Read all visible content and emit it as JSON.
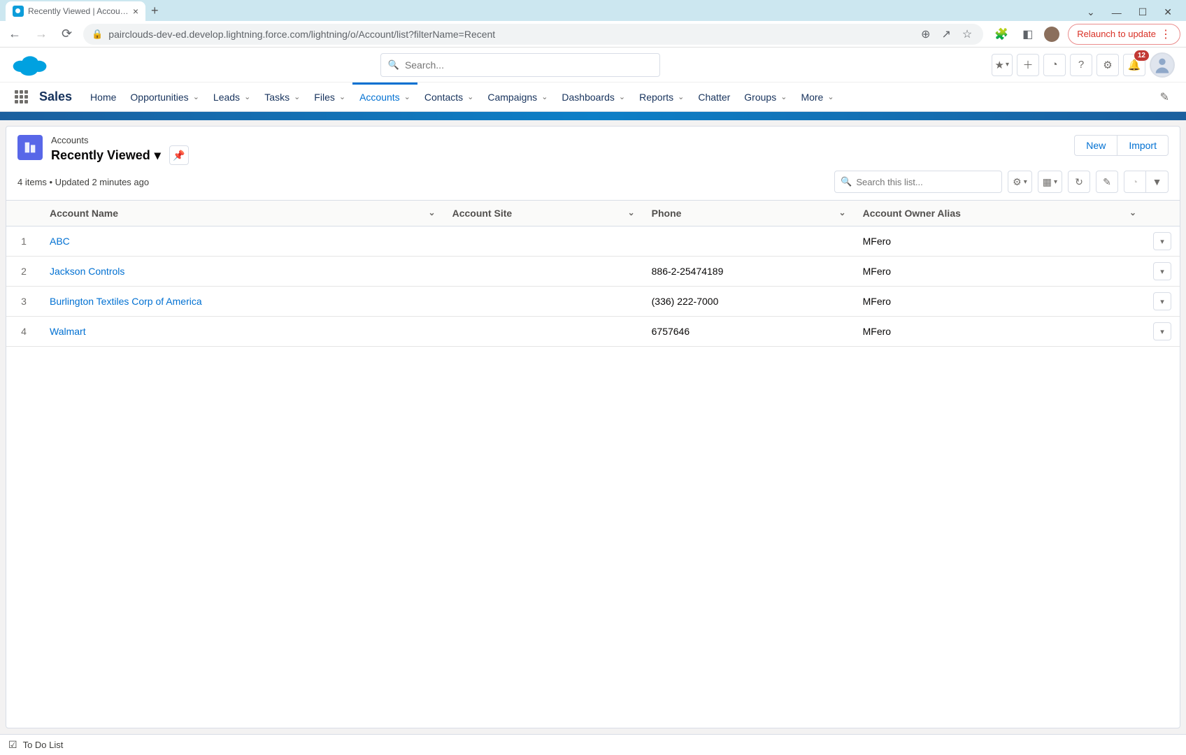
{
  "browser": {
    "tab_title": "Recently Viewed | Accounts | Sal",
    "url": "pairclouds-dev-ed.develop.lightning.force.com/lightning/o/Account/list?filterName=Recent",
    "relaunch_label": "Relaunch to update"
  },
  "header": {
    "search_placeholder": "Search...",
    "notification_count": "12"
  },
  "nav": {
    "app_name": "Sales",
    "tabs": [
      "Home",
      "Opportunities",
      "Leads",
      "Tasks",
      "Files",
      "Accounts",
      "Contacts",
      "Campaigns",
      "Dashboards",
      "Reports",
      "Chatter",
      "Groups",
      "More"
    ],
    "active_tab": "Accounts"
  },
  "list": {
    "object_label": "Accounts",
    "view_name": "Recently Viewed",
    "status": "4 items • Updated 2 minutes ago",
    "actions": {
      "new": "New",
      "import": "Import"
    },
    "search_placeholder": "Search this list..."
  },
  "table": {
    "columns": [
      "Account Name",
      "Account Site",
      "Phone",
      "Account Owner Alias"
    ],
    "rows": [
      {
        "n": "1",
        "name": "ABC",
        "site": "",
        "phone": "",
        "owner": "MFero"
      },
      {
        "n": "2",
        "name": "Jackson Controls",
        "site": "",
        "phone": "886-2-25474189",
        "owner": "MFero"
      },
      {
        "n": "3",
        "name": "Burlington Textiles Corp of America",
        "site": "",
        "phone": "(336) 222-7000",
        "owner": "MFero"
      },
      {
        "n": "4",
        "name": "Walmart",
        "site": "",
        "phone": "6757646",
        "owner": "MFero"
      }
    ]
  },
  "footer": {
    "todo_label": "To Do List"
  }
}
